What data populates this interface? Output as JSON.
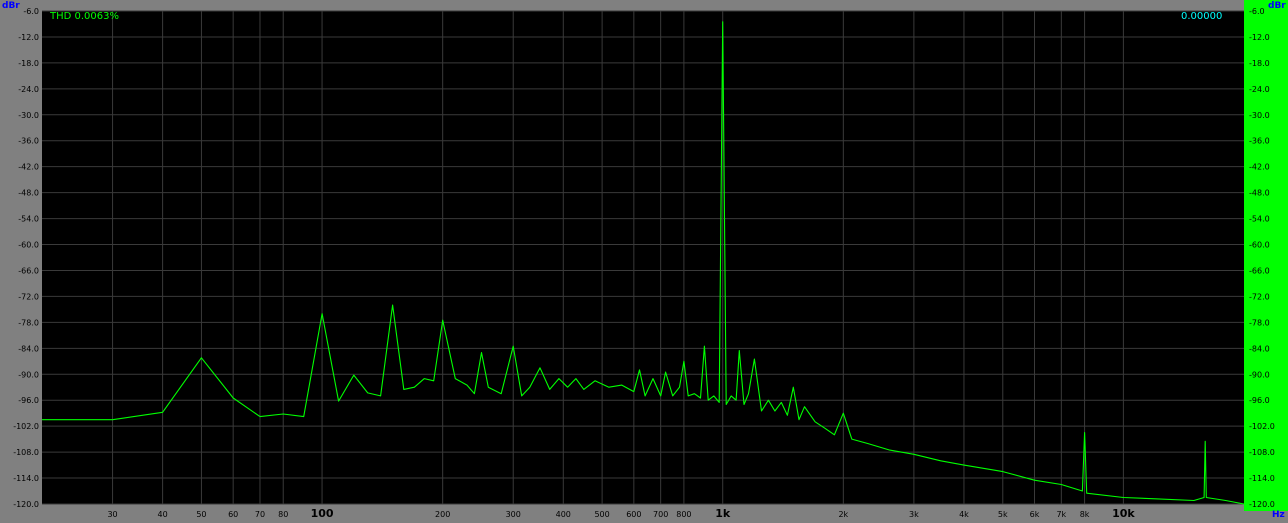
{
  "readouts": {
    "thd": "THD 0.0063%",
    "value": "0.00000"
  },
  "chart_data": {
    "type": "line",
    "x_scale": "log",
    "xlim": [
      20,
      20000
    ],
    "ylim": [
      -120,
      -6
    ],
    "y_unit": "dBr",
    "x_unit": "Hz",
    "yticks": [
      -6,
      -12,
      -18,
      -24,
      -30,
      -36,
      -42,
      -48,
      -54,
      -60,
      -66,
      -72,
      -78,
      -84,
      -90,
      -96,
      -102,
      -108,
      -114,
      -120
    ],
    "ytick_labels": [
      "-6.0",
      "-12.0",
      "-18.0",
      "-24.0",
      "-30.0",
      "-36.0",
      "-42.0",
      "-48.0",
      "-54.0",
      "-60.0",
      "-66.0",
      "-72.0",
      "-78.0",
      "-84.0",
      "-90.0",
      "-96.0",
      "-102.0",
      "-108.0",
      "-114.0",
      "-120.0"
    ],
    "xticks": [
      30,
      40,
      50,
      60,
      70,
      80,
      100,
      200,
      300,
      400,
      500,
      600,
      700,
      800,
      1000,
      2000,
      3000,
      4000,
      5000,
      6000,
      7000,
      8000,
      10000
    ],
    "xtick_labels": [
      "30",
      "40",
      "50",
      "60",
      "70",
      "80",
      "100",
      "200",
      "300",
      "400",
      "500",
      "600",
      "700",
      "800",
      "1k",
      "2k",
      "3k",
      "4k",
      "5k",
      "6k",
      "7k",
      "8k",
      "10k"
    ],
    "xtick_major": [
      false,
      false,
      false,
      false,
      false,
      false,
      true,
      false,
      false,
      false,
      false,
      false,
      false,
      false,
      true,
      false,
      false,
      false,
      false,
      false,
      false,
      false,
      true
    ],
    "grid": true,
    "colors": {
      "background": "#000000",
      "frame": "#808080",
      "right_axis_panel": "#00ff00",
      "grid": "#3a3a3a",
      "trace": "#00ff00",
      "thd_text": "#00ff00",
      "value_text": "#00ffff",
      "unit_text": "#0000ff"
    },
    "series": [
      {
        "points": [
          [
            20,
            -100.5
          ],
          [
            30,
            -100.5
          ],
          [
            40,
            -98.8
          ],
          [
            50,
            -86.2
          ],
          [
            60,
            -95.5
          ],
          [
            70,
            -99.8
          ],
          [
            80,
            -99.2
          ],
          [
            90,
            -99.8
          ],
          [
            100,
            -76.0
          ],
          [
            110,
            -96.2
          ],
          [
            120,
            -90.2
          ],
          [
            130,
            -94.3
          ],
          [
            140,
            -95.0
          ],
          [
            150,
            -74.0
          ],
          [
            160,
            -93.5
          ],
          [
            170,
            -93.0
          ],
          [
            180,
            -91.0
          ],
          [
            190,
            -91.5
          ],
          [
            200,
            -77.5
          ],
          [
            215,
            -91.0
          ],
          [
            230,
            -92.5
          ],
          [
            240,
            -94.5
          ],
          [
            250,
            -85.0
          ],
          [
            260,
            -93.0
          ],
          [
            280,
            -94.5
          ],
          [
            300,
            -83.5
          ],
          [
            315,
            -95.0
          ],
          [
            330,
            -93.0
          ],
          [
            350,
            -88.5
          ],
          [
            370,
            -93.5
          ],
          [
            390,
            -91.0
          ],
          [
            410,
            -93.0
          ],
          [
            430,
            -91.0
          ],
          [
            450,
            -93.5
          ],
          [
            480,
            -91.5
          ],
          [
            520,
            -93.0
          ],
          [
            560,
            -92.5
          ],
          [
            600,
            -94.0
          ],
          [
            620,
            -89.0
          ],
          [
            640,
            -95.0
          ],
          [
            670,
            -91.0
          ],
          [
            700,
            -95.0
          ],
          [
            720,
            -89.5
          ],
          [
            750,
            -95.0
          ],
          [
            780,
            -93.0
          ],
          [
            800,
            -87.0
          ],
          [
            820,
            -95.0
          ],
          [
            850,
            -94.5
          ],
          [
            880,
            -95.5
          ],
          [
            900,
            -83.5
          ],
          [
            920,
            -96.0
          ],
          [
            950,
            -95.0
          ],
          [
            980,
            -96.5
          ],
          [
            1000,
            -8.5
          ],
          [
            1020,
            -97.0
          ],
          [
            1050,
            -95.0
          ],
          [
            1080,
            -96.0
          ],
          [
            1100,
            -84.5
          ],
          [
            1130,
            -97.0
          ],
          [
            1160,
            -94.5
          ],
          [
            1200,
            -86.5
          ],
          [
            1250,
            -98.5
          ],
          [
            1300,
            -96.0
          ],
          [
            1350,
            -98.5
          ],
          [
            1400,
            -96.5
          ],
          [
            1450,
            -99.5
          ],
          [
            1500,
            -93.0
          ],
          [
            1550,
            -100.5
          ],
          [
            1600,
            -97.5
          ],
          [
            1700,
            -101.0
          ],
          [
            1800,
            -102.5
          ],
          [
            1900,
            -104.0
          ],
          [
            2000,
            -99.0
          ],
          [
            2100,
            -105.0
          ],
          [
            2300,
            -106.0
          ],
          [
            2600,
            -107.5
          ],
          [
            3000,
            -108.5
          ],
          [
            3500,
            -110.0
          ],
          [
            4000,
            -111.0
          ],
          [
            5000,
            -112.5
          ],
          [
            6000,
            -114.5
          ],
          [
            7000,
            -115.5
          ],
          [
            7900,
            -117.0
          ],
          [
            8000,
            -103.5
          ],
          [
            8100,
            -117.5
          ],
          [
            10000,
            -118.5
          ],
          [
            12000,
            -118.8
          ],
          [
            15000,
            -119.2
          ],
          [
            15900,
            -118.5
          ],
          [
            16000,
            -105.5
          ],
          [
            16100,
            -118.5
          ],
          [
            18000,
            -119.2
          ],
          [
            20000,
            -120.0
          ]
        ]
      }
    ]
  }
}
